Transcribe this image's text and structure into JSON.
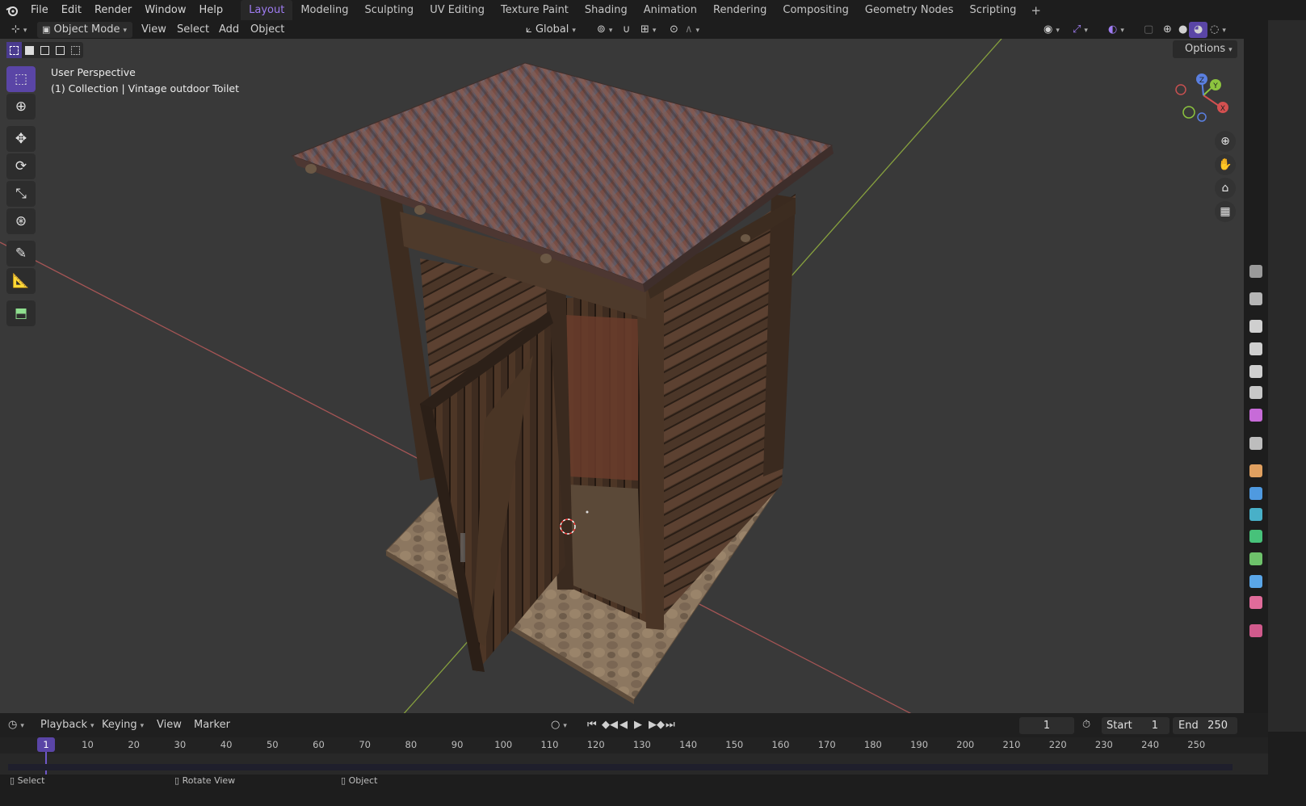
{
  "topbar": {
    "menu": [
      "File",
      "Edit",
      "Render",
      "Window",
      "Help"
    ],
    "workspaces": [
      "Layout",
      "Modeling",
      "Sculpting",
      "UV Editing",
      "Texture Paint",
      "Shading",
      "Animation",
      "Rendering",
      "Compositing",
      "Geometry Nodes",
      "Scripting"
    ],
    "active_workspace": "Layout",
    "add_icon": "plus-icon"
  },
  "header": {
    "mode": "Object Mode",
    "menus": [
      "View",
      "Select",
      "Add",
      "Object"
    ],
    "orientation": "Global"
  },
  "viewport": {
    "perspective_label": "User Perspective",
    "collection_label": "(1) Collection | Vintage outdoor Toilet",
    "options_label": "Options",
    "gizmo_axes": [
      "X",
      "Y",
      "Z"
    ],
    "background_color": "#393939",
    "x_axis_color": "#b85a5a",
    "y_axis_color": "#8aa640"
  },
  "timeline": {
    "menus": [
      "Playback",
      "Keying",
      "View",
      "Marker"
    ],
    "current_frame": "1",
    "start_label": "Start",
    "start_value": "1",
    "end_label": "End",
    "end_value": "250",
    "frame_ticks": [
      "1",
      "10",
      "20",
      "30",
      "40",
      "50",
      "60",
      "70",
      "80",
      "90",
      "100",
      "110",
      "120",
      "130",
      "140",
      "150",
      "160",
      "170",
      "180",
      "190",
      "200",
      "210",
      "220",
      "230",
      "240",
      "250"
    ]
  },
  "statusbar": {
    "items": [
      "Select",
      "Rotate View",
      "Object"
    ]
  },
  "colors": {
    "accent": "#9f7cf2",
    "active_tool": "#5a45a6"
  }
}
